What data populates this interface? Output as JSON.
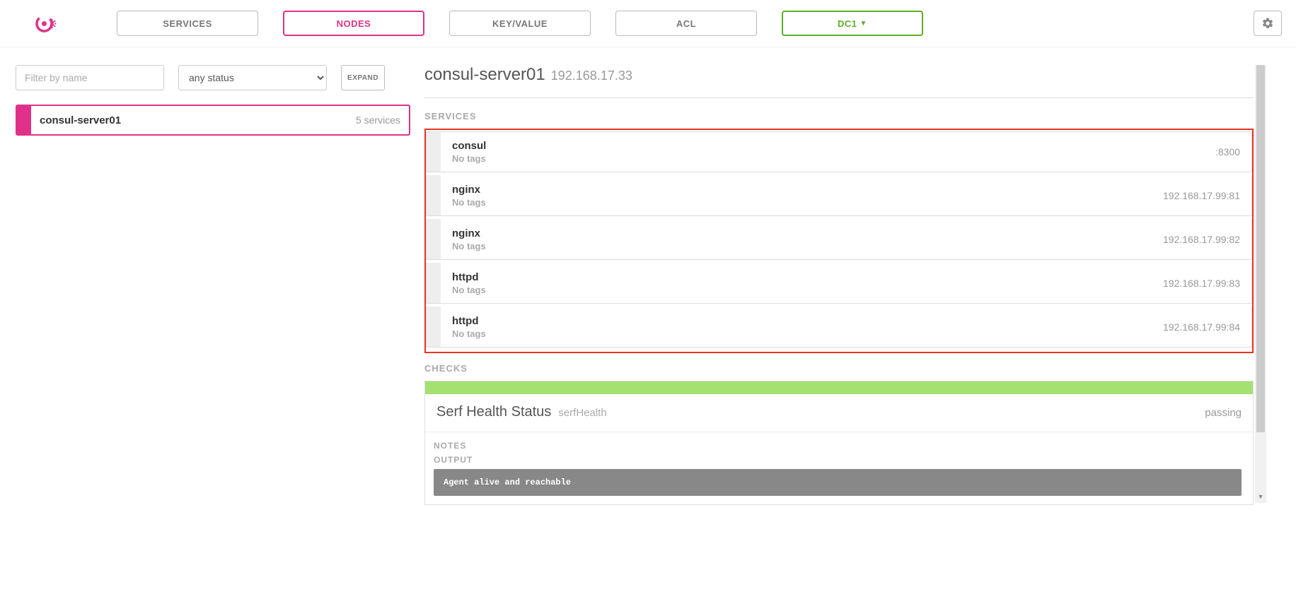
{
  "nav": {
    "services": "SERVICES",
    "nodes": "NODES",
    "keyvalue": "KEY/VALUE",
    "acl": "ACL",
    "dc": "DC1"
  },
  "filter": {
    "placeholder": "Filter by name",
    "status_selected": "any status",
    "expand": "EXPAND"
  },
  "nodes": [
    {
      "name": "consul-server01",
      "count": "5 services"
    }
  ],
  "detail": {
    "title": "consul-server01",
    "ip": "192.168.17.33",
    "services_label": "SERVICES",
    "checks_label": "CHECKS",
    "services": [
      {
        "name": "consul",
        "tags": "No tags",
        "addr": ":8300"
      },
      {
        "name": "nginx",
        "tags": "No tags",
        "addr": "192.168.17.99:81"
      },
      {
        "name": "nginx",
        "tags": "No tags",
        "addr": "192.168.17.99:82"
      },
      {
        "name": "httpd",
        "tags": "No tags",
        "addr": "192.168.17.99:83"
      },
      {
        "name": "httpd",
        "tags": "No tags",
        "addr": "192.168.17.99:84"
      }
    ],
    "check": {
      "title": "Serf Health Status",
      "id": "serfHealth",
      "status": "passing",
      "notes_label": "NOTES",
      "output_label": "OUTPUT",
      "output": "Agent alive and reachable"
    }
  }
}
